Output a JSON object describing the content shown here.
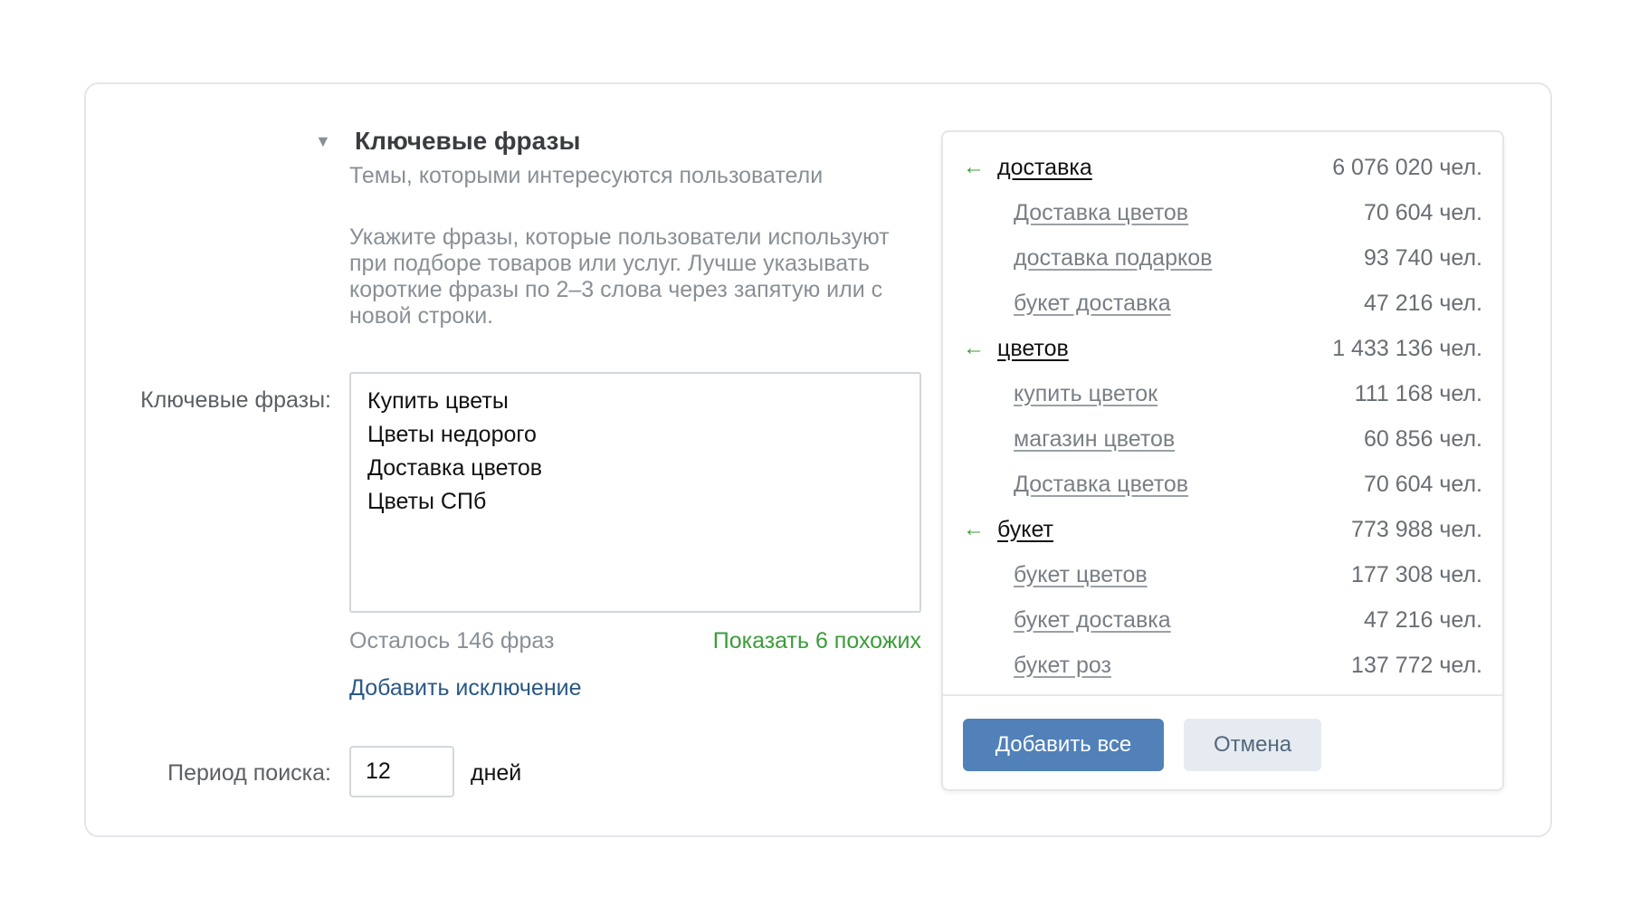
{
  "section": {
    "title": "Ключевые фразы",
    "subtitle": "Темы, которыми интересуются пользователи",
    "hint": "Укажите фразы, которые пользователи используют при подборе товаров или услуг. Лучше указывать короткие фразы по 2–3 слова через запятую или с новой строки."
  },
  "keywords": {
    "label": "Ключевые фразы:",
    "lines": [
      "Купить цветы",
      "Цветы недорого",
      "Доставка цветов",
      "Цветы СПб"
    ],
    "remaining": "Осталось 146 фраз",
    "show_similar": "Показать 6 похожих",
    "add_exclusion": "Добавить исключение"
  },
  "period": {
    "label": "Период поиска:",
    "value": "12",
    "unit": "дней"
  },
  "suggestions": {
    "items": [
      {
        "type": "group",
        "phrase": "доставка",
        "count": "6 076 020 чел."
      },
      {
        "type": "child",
        "phrase": "Доставка цветов",
        "count": "70 604 чел."
      },
      {
        "type": "child",
        "phrase": "доставка подарков",
        "count": "93 740 чел."
      },
      {
        "type": "child",
        "phrase": "букет доставка",
        "count": "47 216 чел."
      },
      {
        "type": "group",
        "phrase": "цветов",
        "count": "1 433 136 чел."
      },
      {
        "type": "child",
        "phrase": "купить цветок",
        "count": "111 168 чел."
      },
      {
        "type": "child",
        "phrase": "магазин цветов",
        "count": "60 856 чел."
      },
      {
        "type": "child",
        "phrase": "Доставка цветов",
        "count": "70 604 чел."
      },
      {
        "type": "group",
        "phrase": "букет",
        "count": "773 988 чел."
      },
      {
        "type": "child",
        "phrase": "букет цветов",
        "count": "177 308 чел."
      },
      {
        "type": "child",
        "phrase": "букет доставка",
        "count": "47 216 чел."
      },
      {
        "type": "child",
        "phrase": "букет роз",
        "count": "137 772 чел."
      }
    ],
    "add_all": "Добавить все",
    "cancel": "Отмена"
  },
  "icons": {
    "collapse": "triangle-down-icon",
    "group_arrow": "arrow-left-icon"
  },
  "colors": {
    "link_green": "#3a9d3a",
    "link_blue": "#2a5885",
    "primary_button": "#5181b8",
    "secondary_button": "#e5ebf1"
  }
}
